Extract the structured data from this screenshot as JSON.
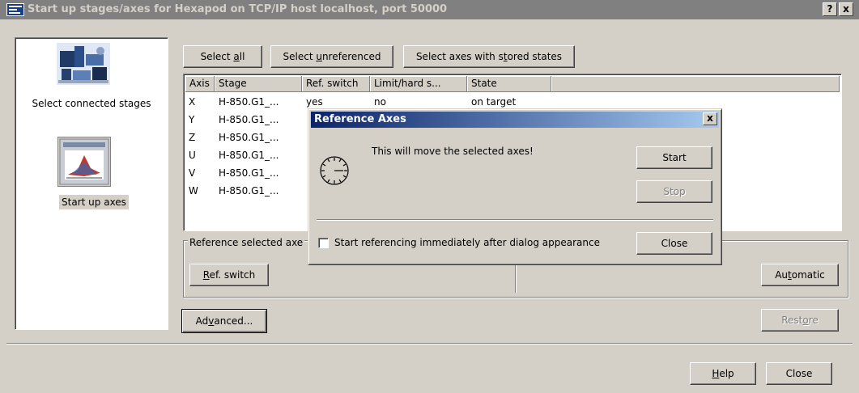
{
  "window": {
    "title": "Start up stages/axes for Hexapod on TCP/IP host localhost, port 50000",
    "help_button": "?",
    "close_button": "x"
  },
  "sidebar": {
    "items": [
      {
        "label": "Select connected stages",
        "icon": "stages-photo-icon"
      },
      {
        "label": "Start up axes",
        "icon": "axes-chart-icon",
        "selected": true
      }
    ]
  },
  "toolbar": {
    "select_all": {
      "pre": "Select ",
      "u": "a",
      "post": "ll"
    },
    "select_unreferenced": {
      "pre": "Select ",
      "u": "u",
      "post": "nreferenced"
    },
    "select_stored": {
      "pre": "Select axes with s",
      "u": "t",
      "post": "ored states"
    }
  },
  "grid": {
    "columns": [
      "Axis",
      "Stage",
      "Ref. switch",
      "Limit/hard s...",
      "State"
    ],
    "rows": [
      {
        "axis": "X",
        "stage": "H-850.G1_...",
        "ref": "yes",
        "limit": "no",
        "state": "on target"
      },
      {
        "axis": "Y",
        "stage": "H-850.G1_...",
        "ref": "",
        "limit": "",
        "state": ""
      },
      {
        "axis": "Z",
        "stage": "H-850.G1_...",
        "ref": "",
        "limit": "",
        "state": ""
      },
      {
        "axis": "U",
        "stage": "H-850.G1_...",
        "ref": "",
        "limit": "",
        "state": ""
      },
      {
        "axis": "V",
        "stage": "H-850.G1_...",
        "ref": "",
        "limit": "",
        "state": ""
      },
      {
        "axis": "W",
        "stage": "H-850.G1_...",
        "ref": "",
        "limit": "",
        "state": ""
      }
    ]
  },
  "reference_group": {
    "label": "Reference selected axe",
    "ref_switch": {
      "u": "R",
      "post": "ef. switch"
    },
    "automatic": {
      "pre": "Au",
      "u": "t",
      "post": "omatic"
    }
  },
  "bottom": {
    "advanced": {
      "pre": "Ad",
      "u": "v",
      "post": "anced..."
    },
    "restore": {
      "pre": "Rest",
      "u": "o",
      "post": "re"
    },
    "help": {
      "u": "H",
      "post": "elp"
    },
    "close": "Close"
  },
  "dialog": {
    "title": "Reference Axes",
    "close_button": "x",
    "message": "This will move the selected axes!",
    "start": "Start",
    "stop": "Stop",
    "checkbox_label": "Start referencing immediately after dialog appearance",
    "checkbox_checked": false,
    "close": "Close"
  }
}
